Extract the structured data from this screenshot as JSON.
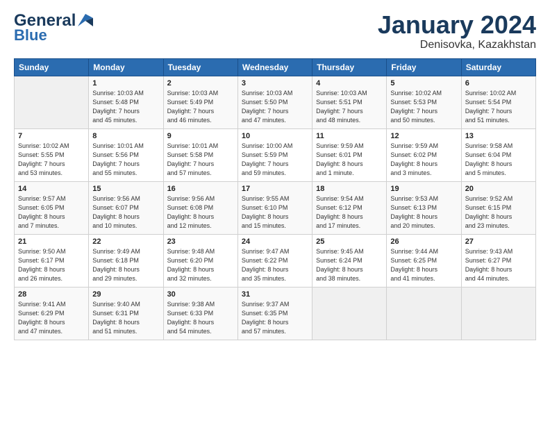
{
  "header": {
    "logo_line1": "General",
    "logo_line2": "Blue",
    "month": "January 2024",
    "location": "Denisovka, Kazakhstan"
  },
  "weekdays": [
    "Sunday",
    "Monday",
    "Tuesday",
    "Wednesday",
    "Thursday",
    "Friday",
    "Saturday"
  ],
  "weeks": [
    [
      {
        "day": "",
        "info": ""
      },
      {
        "day": "1",
        "info": "Sunrise: 10:03 AM\nSunset: 5:48 PM\nDaylight: 7 hours\nand 45 minutes."
      },
      {
        "day": "2",
        "info": "Sunrise: 10:03 AM\nSunset: 5:49 PM\nDaylight: 7 hours\nand 46 minutes."
      },
      {
        "day": "3",
        "info": "Sunrise: 10:03 AM\nSunset: 5:50 PM\nDaylight: 7 hours\nand 47 minutes."
      },
      {
        "day": "4",
        "info": "Sunrise: 10:03 AM\nSunset: 5:51 PM\nDaylight: 7 hours\nand 48 minutes."
      },
      {
        "day": "5",
        "info": "Sunrise: 10:02 AM\nSunset: 5:53 PM\nDaylight: 7 hours\nand 50 minutes."
      },
      {
        "day": "6",
        "info": "Sunrise: 10:02 AM\nSunset: 5:54 PM\nDaylight: 7 hours\nand 51 minutes."
      }
    ],
    [
      {
        "day": "7",
        "info": "Sunrise: 10:02 AM\nSunset: 5:55 PM\nDaylight: 7 hours\nand 53 minutes."
      },
      {
        "day": "8",
        "info": "Sunrise: 10:01 AM\nSunset: 5:56 PM\nDaylight: 7 hours\nand 55 minutes."
      },
      {
        "day": "9",
        "info": "Sunrise: 10:01 AM\nSunset: 5:58 PM\nDaylight: 7 hours\nand 57 minutes."
      },
      {
        "day": "10",
        "info": "Sunrise: 10:00 AM\nSunset: 5:59 PM\nDaylight: 7 hours\nand 59 minutes."
      },
      {
        "day": "11",
        "info": "Sunrise: 9:59 AM\nSunset: 6:01 PM\nDaylight: 8 hours\nand 1 minute."
      },
      {
        "day": "12",
        "info": "Sunrise: 9:59 AM\nSunset: 6:02 PM\nDaylight: 8 hours\nand 3 minutes."
      },
      {
        "day": "13",
        "info": "Sunrise: 9:58 AM\nSunset: 6:04 PM\nDaylight: 8 hours\nand 5 minutes."
      }
    ],
    [
      {
        "day": "14",
        "info": "Sunrise: 9:57 AM\nSunset: 6:05 PM\nDaylight: 8 hours\nand 7 minutes."
      },
      {
        "day": "15",
        "info": "Sunrise: 9:56 AM\nSunset: 6:07 PM\nDaylight: 8 hours\nand 10 minutes."
      },
      {
        "day": "16",
        "info": "Sunrise: 9:56 AM\nSunset: 6:08 PM\nDaylight: 8 hours\nand 12 minutes."
      },
      {
        "day": "17",
        "info": "Sunrise: 9:55 AM\nSunset: 6:10 PM\nDaylight: 8 hours\nand 15 minutes."
      },
      {
        "day": "18",
        "info": "Sunrise: 9:54 AM\nSunset: 6:12 PM\nDaylight: 8 hours\nand 17 minutes."
      },
      {
        "day": "19",
        "info": "Sunrise: 9:53 AM\nSunset: 6:13 PM\nDaylight: 8 hours\nand 20 minutes."
      },
      {
        "day": "20",
        "info": "Sunrise: 9:52 AM\nSunset: 6:15 PM\nDaylight: 8 hours\nand 23 minutes."
      }
    ],
    [
      {
        "day": "21",
        "info": "Sunrise: 9:50 AM\nSunset: 6:17 PM\nDaylight: 8 hours\nand 26 minutes."
      },
      {
        "day": "22",
        "info": "Sunrise: 9:49 AM\nSunset: 6:18 PM\nDaylight: 8 hours\nand 29 minutes."
      },
      {
        "day": "23",
        "info": "Sunrise: 9:48 AM\nSunset: 6:20 PM\nDaylight: 8 hours\nand 32 minutes."
      },
      {
        "day": "24",
        "info": "Sunrise: 9:47 AM\nSunset: 6:22 PM\nDaylight: 8 hours\nand 35 minutes."
      },
      {
        "day": "25",
        "info": "Sunrise: 9:45 AM\nSunset: 6:24 PM\nDaylight: 8 hours\nand 38 minutes."
      },
      {
        "day": "26",
        "info": "Sunrise: 9:44 AM\nSunset: 6:25 PM\nDaylight: 8 hours\nand 41 minutes."
      },
      {
        "day": "27",
        "info": "Sunrise: 9:43 AM\nSunset: 6:27 PM\nDaylight: 8 hours\nand 44 minutes."
      }
    ],
    [
      {
        "day": "28",
        "info": "Sunrise: 9:41 AM\nSunset: 6:29 PM\nDaylight: 8 hours\nand 47 minutes."
      },
      {
        "day": "29",
        "info": "Sunrise: 9:40 AM\nSunset: 6:31 PM\nDaylight: 8 hours\nand 51 minutes."
      },
      {
        "day": "30",
        "info": "Sunrise: 9:38 AM\nSunset: 6:33 PM\nDaylight: 8 hours\nand 54 minutes."
      },
      {
        "day": "31",
        "info": "Sunrise: 9:37 AM\nSunset: 6:35 PM\nDaylight: 8 hours\nand 57 minutes."
      },
      {
        "day": "",
        "info": ""
      },
      {
        "day": "",
        "info": ""
      },
      {
        "day": "",
        "info": ""
      }
    ]
  ]
}
